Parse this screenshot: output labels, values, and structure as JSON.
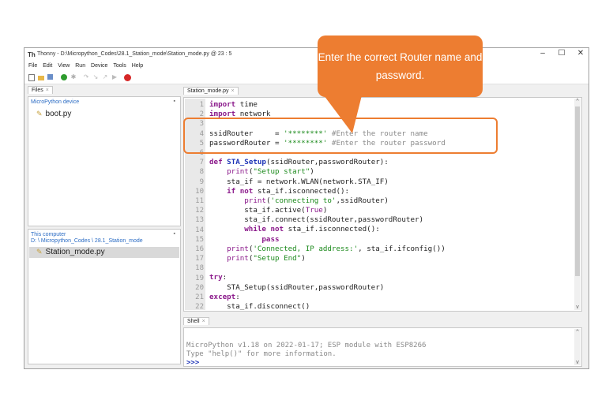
{
  "window": {
    "app_logo": "Th",
    "title": "Thonny - D:\\Micropython_Codes\\28.1_Station_mode\\Station_mode.py @ 23 : 5",
    "controls": [
      "–",
      "☐",
      "✕"
    ]
  },
  "menu": [
    "File",
    "Edit",
    "View",
    "Run",
    "Device",
    "Tools",
    "Help"
  ],
  "toolbar": {
    "icons": [
      "new-file-icon",
      "open-folder-icon",
      "save-icon",
      "run-icon",
      "debug-icon",
      "step-over-icon",
      "step-into-icon",
      "step-out-icon",
      "resume-icon",
      "stop-icon"
    ],
    "colors": {
      "run": "#2e9c2e",
      "stop": "#d62828"
    }
  },
  "files_panel": {
    "tab_label": "Files",
    "device_header": "MicroPython device",
    "device_files": [
      "boot.py"
    ],
    "computer_header": "This computer",
    "computer_path": "D: \\ Micropython_Codes \\ 28.1_Station_mode",
    "computer_files": [
      "Station_mode.py"
    ]
  },
  "editor": {
    "tab_label": "Station_mode.py",
    "lines": [
      [
        [
          "kw",
          "import"
        ],
        [
          "tx",
          " time"
        ]
      ],
      [
        [
          "kw",
          "import"
        ],
        [
          "tx",
          " network"
        ]
      ],
      [],
      [
        [
          "tx",
          "ssidRouter     = "
        ],
        [
          "st",
          "'********'"
        ],
        [
          "cm",
          " #Enter the router name"
        ]
      ],
      [
        [
          "tx",
          "passwordRouter = "
        ],
        [
          "st",
          "'********'"
        ],
        [
          "cm",
          " #Enter the router password"
        ]
      ],
      [],
      [
        [
          "kw",
          "def"
        ],
        [
          "tx",
          " "
        ],
        [
          "fn",
          "STA_Setup"
        ],
        [
          "tx",
          "(ssidRouter,passwordRouter):"
        ]
      ],
      [
        [
          "tx",
          "    "
        ],
        [
          "kw2",
          "print"
        ],
        [
          "tx",
          "("
        ],
        [
          "st",
          "\"Setup start\""
        ],
        [
          "tx",
          ")"
        ]
      ],
      [
        [
          "tx",
          "    sta_if = network.WLAN(network.STA_IF)"
        ]
      ],
      [
        [
          "tx",
          "    "
        ],
        [
          "kw",
          "if not"
        ],
        [
          "tx",
          " sta_if.isconnected():"
        ]
      ],
      [
        [
          "tx",
          "        "
        ],
        [
          "kw2",
          "print"
        ],
        [
          "tx",
          "("
        ],
        [
          "st",
          "'connecting to'"
        ],
        [
          "tx",
          ",ssidRouter)"
        ]
      ],
      [
        [
          "tx",
          "        sta_if.active("
        ],
        [
          "kw2",
          "True"
        ],
        [
          "tx",
          ")"
        ]
      ],
      [
        [
          "tx",
          "        sta_if.connect(ssidRouter,passwordRouter)"
        ]
      ],
      [
        [
          "tx",
          "        "
        ],
        [
          "kw",
          "while not"
        ],
        [
          "tx",
          " sta_if.isconnected():"
        ]
      ],
      [
        [
          "tx",
          "            "
        ],
        [
          "kw",
          "pass"
        ]
      ],
      [
        [
          "tx",
          "    "
        ],
        [
          "kw2",
          "print"
        ],
        [
          "tx",
          "("
        ],
        [
          "st",
          "'Connected, IP address:'"
        ],
        [
          "tx",
          ", sta_if.ifconfig())"
        ]
      ],
      [
        [
          "tx",
          "    "
        ],
        [
          "kw2",
          "print"
        ],
        [
          "tx",
          "("
        ],
        [
          "st",
          "\"Setup End\""
        ],
        [
          "tx",
          ")"
        ]
      ],
      [],
      [
        [
          "kw",
          "try"
        ],
        [
          "tx",
          ":"
        ]
      ],
      [
        [
          "tx",
          "    STA_Setup(ssidRouter,passwordRouter)"
        ]
      ],
      [
        [
          "kw",
          "except"
        ],
        [
          "tx",
          ":"
        ]
      ],
      [
        [
          "tx",
          "    sta_if.disconnect()"
        ]
      ]
    ]
  },
  "shell": {
    "tab_label": "Shell",
    "lines": [
      "MicroPython v1.18 on 2022-01-17; ESP module with ESP8266",
      "Type \"help()\" for more information."
    ],
    "prompt": ">>>"
  },
  "callout": {
    "text": "Enter the correct Router name and password.",
    "color": "#ed7d31"
  }
}
